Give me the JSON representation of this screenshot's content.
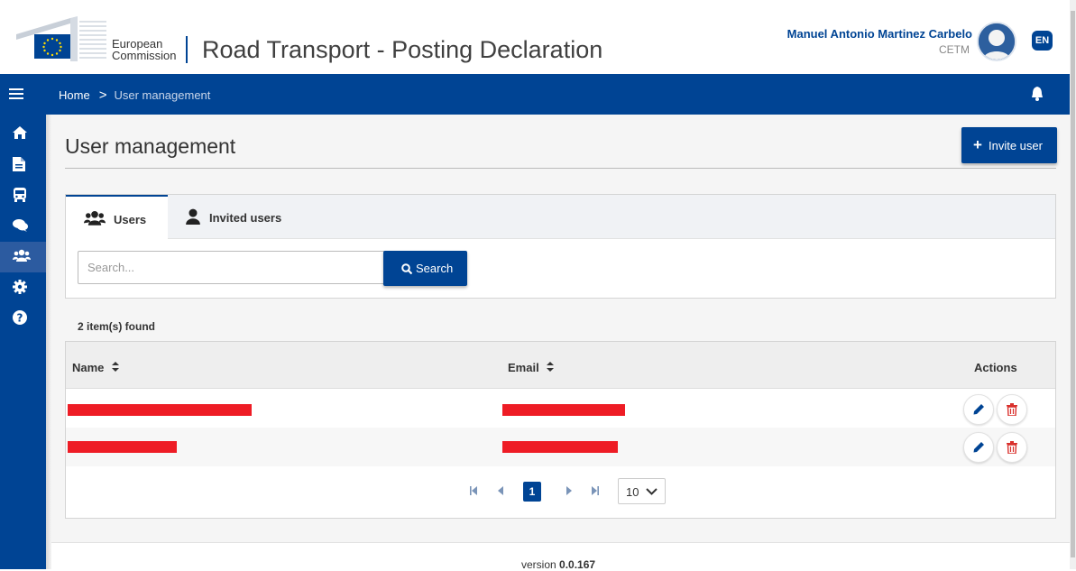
{
  "header": {
    "ec_line1": "European",
    "ec_line2": "Commission",
    "app_title": "Road Transport - Posting Declaration",
    "user_name": "Manuel Antonio Martinez Carbelo",
    "user_org": "CETM",
    "language": "EN"
  },
  "breadcrumb": {
    "home": "Home",
    "separator": ">",
    "current": "User management"
  },
  "sidebar": {
    "items": [
      {
        "icon": "home-icon",
        "active": false
      },
      {
        "icon": "document-icon",
        "active": false
      },
      {
        "icon": "bus-icon",
        "active": false
      },
      {
        "icon": "chat-icon",
        "active": false
      },
      {
        "icon": "users-icon",
        "active": true
      },
      {
        "icon": "gear-icon",
        "active": false
      },
      {
        "icon": "help-icon",
        "active": false
      }
    ]
  },
  "page": {
    "title": "User management",
    "invite_label": "Invite user"
  },
  "tabs": [
    {
      "label": "Users",
      "icon": "users-icon",
      "active": true
    },
    {
      "label": "Invited users",
      "icon": "user-icon",
      "active": false
    }
  ],
  "search": {
    "placeholder": "Search...",
    "button_label": "Search"
  },
  "results": {
    "count_text": "2 item(s) found"
  },
  "table": {
    "columns": [
      "Name",
      "Email",
      "Actions"
    ],
    "rows": [
      {
        "name": "[redacted]",
        "email": "[redacted]"
      },
      {
        "name": "[redacted]",
        "email": "[redacted]"
      }
    ]
  },
  "pagination": {
    "current_page": "1",
    "page_size": "10"
  },
  "footer": {
    "version_label": "version",
    "version_number": "0.0.167"
  },
  "colors": {
    "primary": "#004494",
    "redaction": "#ee1c25",
    "delete": "#d9302c"
  }
}
